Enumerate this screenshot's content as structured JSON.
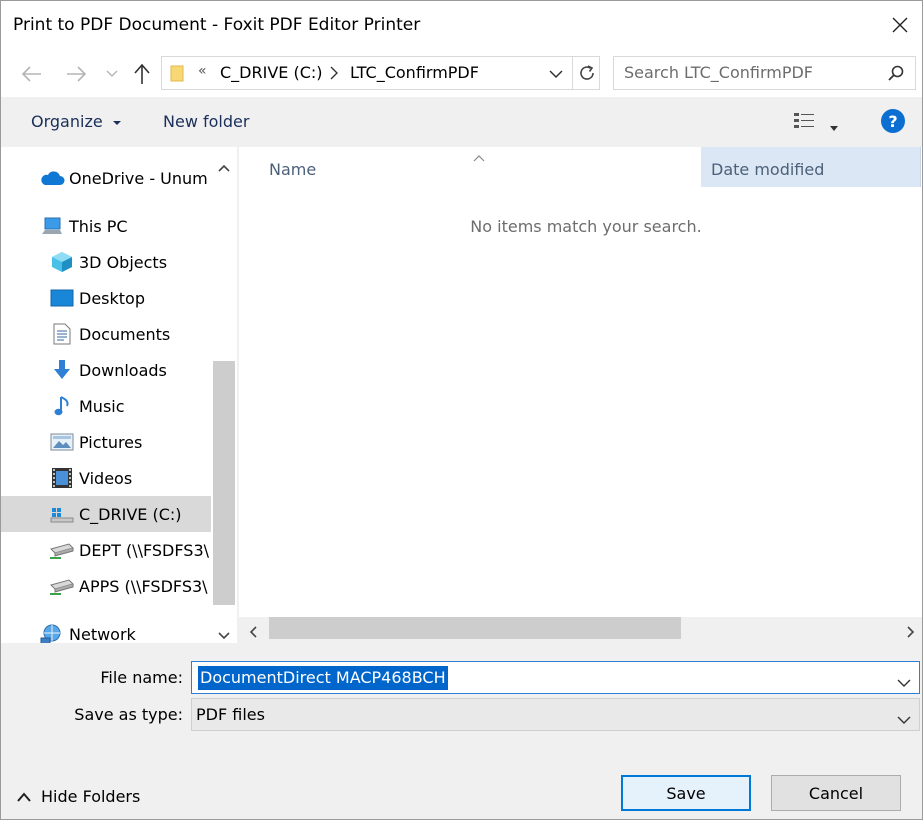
{
  "window": {
    "title": "Print to PDF Document - Foxit PDF Editor Printer"
  },
  "address": {
    "chevrons": "«",
    "segments": [
      "C_DRIVE (C:)",
      "LTC_ConfirmPDF"
    ]
  },
  "search": {
    "placeholder": "Search LTC_ConfirmPDF"
  },
  "toolbar": {
    "organize_label": "Organize",
    "new_folder_label": "New folder",
    "help_label": "?"
  },
  "nav": {
    "items": [
      {
        "label": "OneDrive - Unum",
        "icon": "onedrive-cloud-icon"
      },
      {
        "label": "This PC",
        "icon": "computer-icon"
      },
      {
        "label": "3D Objects",
        "icon": "3d-objects-icon"
      },
      {
        "label": "Desktop",
        "icon": "desktop-icon"
      },
      {
        "label": "Documents",
        "icon": "documents-icon"
      },
      {
        "label": "Downloads",
        "icon": "downloads-icon"
      },
      {
        "label": "Music",
        "icon": "music-icon"
      },
      {
        "label": "Pictures",
        "icon": "pictures-icon"
      },
      {
        "label": "Videos",
        "icon": "videos-icon"
      },
      {
        "label": "C_DRIVE (C:)",
        "icon": "drive-icon",
        "selected": true
      },
      {
        "label": "DEPT (\\\\FSDFS3\\",
        "icon": "network-drive-icon"
      },
      {
        "label": "APPS (\\\\FSDFS3\\",
        "icon": "network-drive-icon"
      },
      {
        "label": "Network",
        "icon": "network-icon"
      }
    ]
  },
  "content": {
    "columns": [
      "Name",
      "Date modified"
    ],
    "empty_message": "No items match your search."
  },
  "form": {
    "file_name_label": "File name:",
    "file_name_value": "DocumentDirect MACP468BCH",
    "save_type_label": "Save as type:",
    "save_type_value": "PDF files"
  },
  "footer": {
    "hide_folders_label": "Hide Folders",
    "save_label": "Save",
    "cancel_label": "Cancel"
  },
  "colors": {
    "accent": "#0078d7",
    "selection": "#0066cc",
    "column_highlight": "#dbe7f4"
  }
}
